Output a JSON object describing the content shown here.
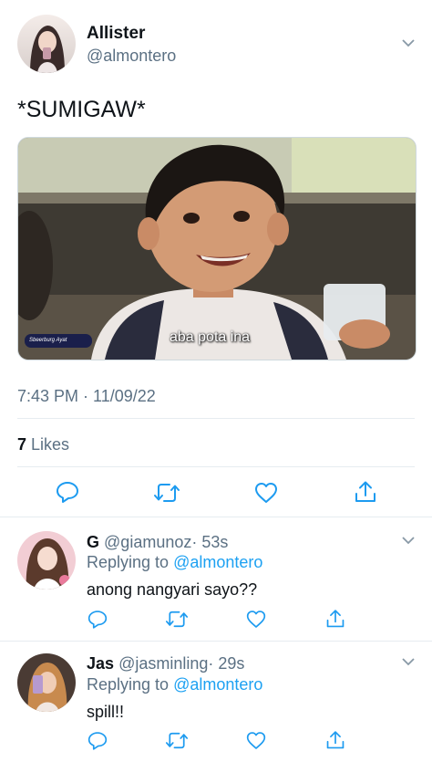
{
  "tweet": {
    "display_name": "Allister",
    "handle": "@almontero",
    "text": "*SUMIGAW*",
    "media": {
      "caption": "aba pota ina",
      "watermark": "Sbeerburg Ayat"
    },
    "timestamp": "7:43 PM · 11/09/22",
    "likes_count": "7",
    "likes_label": "Likes"
  },
  "replies": [
    {
      "display_name": "G",
      "handle": "@giamunoz",
      "time": "· 53s",
      "replying_prefix": "Replying to",
      "replying_to": "@almontero",
      "text": "anong nangyari sayo??"
    },
    {
      "display_name": "Jas",
      "handle": "@jasminling",
      "time": "· 29s",
      "replying_prefix": "Replying to",
      "replying_to": "@almontero",
      "text": "spill!!"
    }
  ],
  "colors": {
    "accent": "#1da1f2",
    "muted": "#5b7083",
    "icon": "#1d9bf0",
    "divider": "#e6ecf0"
  }
}
